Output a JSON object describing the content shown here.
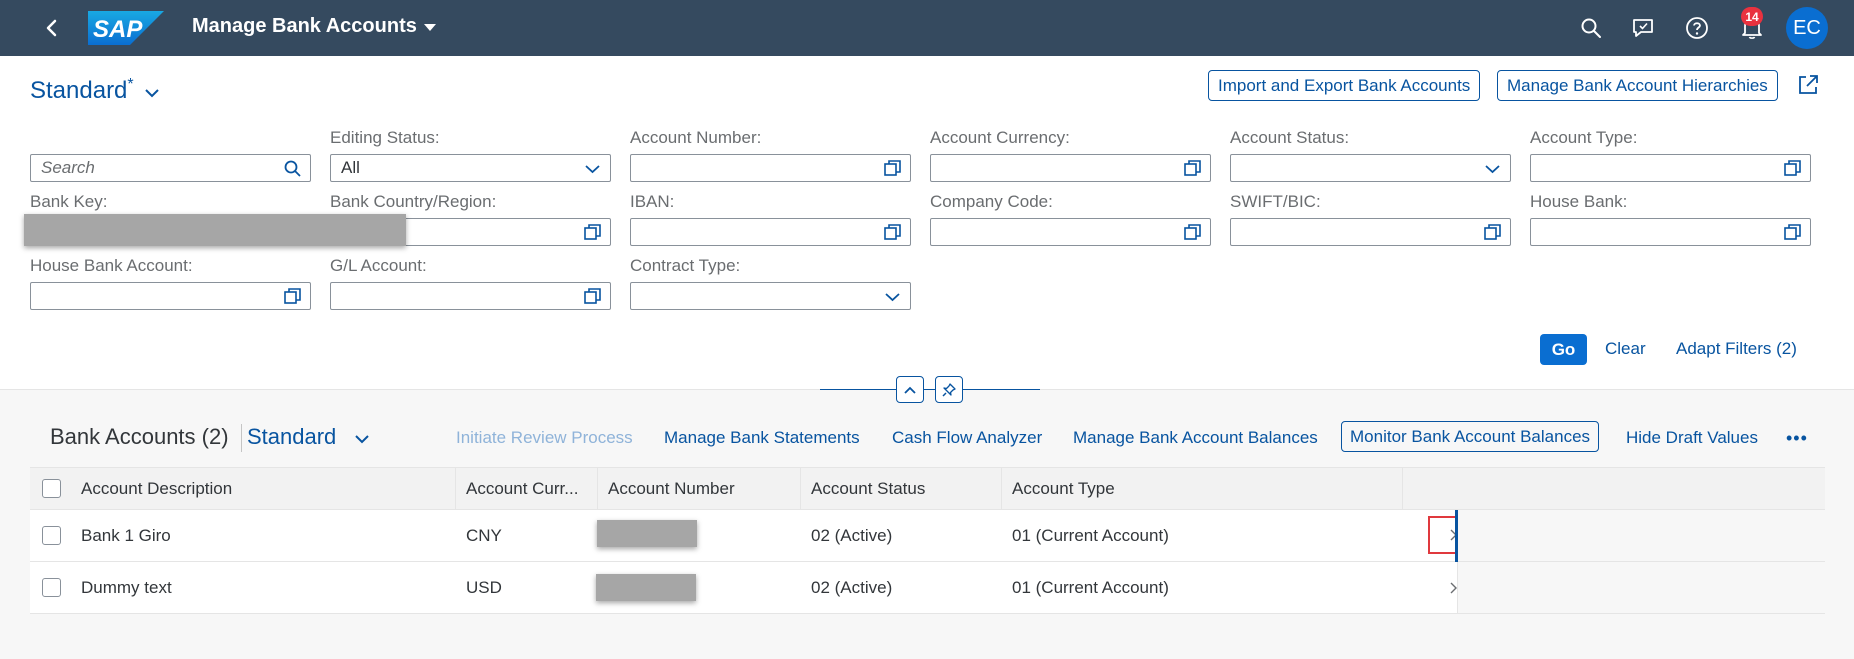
{
  "shell": {
    "logo": "SAP",
    "title": "Manage Bank Accounts",
    "notification_count": "14",
    "avatar_initials": "EC",
    "accent_color": "#354a5f"
  },
  "header": {
    "variant_name": "Standard",
    "variant_modified_marker": "*",
    "import_export_label": "Import and Export Bank Accounts",
    "hierarchies_label": "Manage Bank Account Hierarchies"
  },
  "filters": {
    "search_placeholder": "Search",
    "editing_status_label": "Editing Status:",
    "editing_status_value": "All",
    "account_number_label": "Account Number:",
    "account_currency_label": "Account Currency:",
    "account_status_label": "Account Status:",
    "account_type_label": "Account Type:",
    "bank_key_label": "Bank Key:",
    "bank_country_label": "Bank Country/Region:",
    "iban_label": "IBAN:",
    "company_code_label": "Company Code:",
    "swift_label": "SWIFT/BIC:",
    "house_bank_label": "House Bank:",
    "house_bank_account_label": "House Bank Account:",
    "gl_account_label": "G/L Account:",
    "contract_type_label": "Contract Type:",
    "go_label": "Go",
    "clear_label": "Clear",
    "adapt_label": "Adapt Filters (2)"
  },
  "table_toolbar": {
    "title": "Bank Accounts (2)",
    "variant": "Standard",
    "initiate_review": "Initiate Review Process",
    "manage_statements": "Manage Bank Statements",
    "cash_flow": "Cash Flow Analyzer",
    "manage_balances": "Manage Bank Account Balances",
    "monitor_balances": "Monitor Bank Account Balances",
    "hide_draft": "Hide Draft Values",
    "more": "•••"
  },
  "table": {
    "columns": {
      "description": "Account Description",
      "currency": "Account Curr...",
      "number": "Account Number",
      "status": "Account Status",
      "type": "Account Type"
    },
    "rows": [
      {
        "description": "Bank 1 Giro",
        "currency": "CNY",
        "status": "02 (Active)",
        "type": "01 (Current Account)"
      },
      {
        "description": "Dummy text",
        "currency": "USD",
        "status": "02 (Active)",
        "type": "01 (Current Account)"
      }
    ]
  }
}
